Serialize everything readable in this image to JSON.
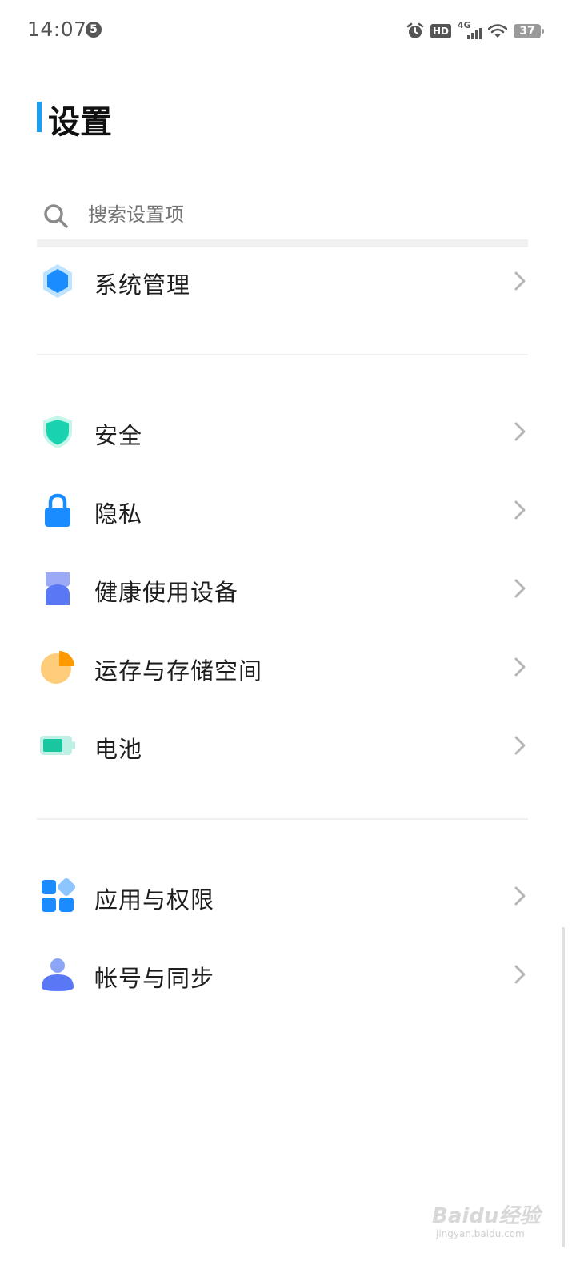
{
  "status_bar": {
    "time": "14:07",
    "notification_count": "5",
    "hd_label": "HD",
    "network_label": "4G",
    "battery_level": "37"
  },
  "header": {
    "title": "设置"
  },
  "search": {
    "placeholder": "搜索设置项"
  },
  "settings": {
    "items": [
      {
        "label": "系统管理",
        "icon": "hexagon-icon",
        "color": "#1a8cff"
      },
      {
        "label": "安全",
        "icon": "shield-icon",
        "color": "#19d3b0"
      },
      {
        "label": "隐私",
        "icon": "lock-icon",
        "color": "#1a8cff"
      },
      {
        "label": "健康使用设备",
        "icon": "hourglass-icon",
        "color": "#5a78f5"
      },
      {
        "label": "运存与存储空间",
        "icon": "pie-icon",
        "color": "#ff9900"
      },
      {
        "label": "电池",
        "icon": "battery-icon",
        "color": "#19c6a0"
      },
      {
        "label": "应用与权限",
        "icon": "apps-grid-icon",
        "color": "#1a8cff"
      },
      {
        "label": "帐号与同步",
        "icon": "account-icon",
        "color": "#6a8af5"
      }
    ]
  },
  "watermark": {
    "text": "Baidu经验",
    "sub": "jingyan.baidu.com"
  }
}
